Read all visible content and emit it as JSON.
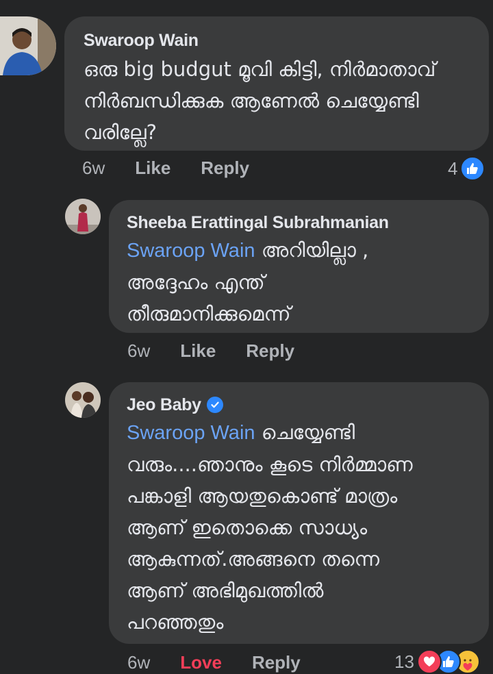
{
  "comments": [
    {
      "author": "Swaroop Wain",
      "lines": [
        "ഒരു big budgut മൂവി കിട്ടി, നിർമാതാവ്",
        "നിർബന്ധിക്കുക ആണേൽ ചെയ്യേണ്ടി",
        "വരില്ലേ?"
      ],
      "time": "6w",
      "like_label": "Like",
      "reply_label": "Reply",
      "reaction_count": "4"
    },
    {
      "author": "Sheeba Erattingal Subrahmanian",
      "mention": "Swaroop Wain",
      "line1_rest": " അറിയില്ലാ ,",
      "lines": [
        "അദ്ദേഹം എന്ത്",
        "തീരുമാനിക്കുമെന്ന്"
      ],
      "time": "6w",
      "like_label": "Like",
      "reply_label": "Reply"
    },
    {
      "author": "Jeo Baby",
      "mention": "Swaroop Wain",
      "line1_rest": " ചെയ്യേണ്ടി",
      "lines": [
        "വരും....ഞാനും കൂടെ നിർമ്മാണ",
        "പങ്കാളി ആയതുകൊണ്ട് മാത്രം",
        "ആണ് ഇതൊക്കെ സാധ്യം",
        "ആകുന്നത്.അങ്ങനെ തന്നെ",
        "ആണ് അഭിമുഖത്തിൽ",
        "പറഞ്ഞതും"
      ],
      "time": "6w",
      "love_label": "Love",
      "reply_label": "Reply",
      "reaction_count": "13"
    }
  ],
  "colors": {
    "background": "#242526",
    "bubble": "#3a3b3c",
    "mention": "#6ba3f5",
    "love": "#f33e58",
    "like_blue": "#2d88ff"
  },
  "icons": [
    "like-icon",
    "love-icon",
    "care-icon",
    "verified-badge-icon"
  ]
}
